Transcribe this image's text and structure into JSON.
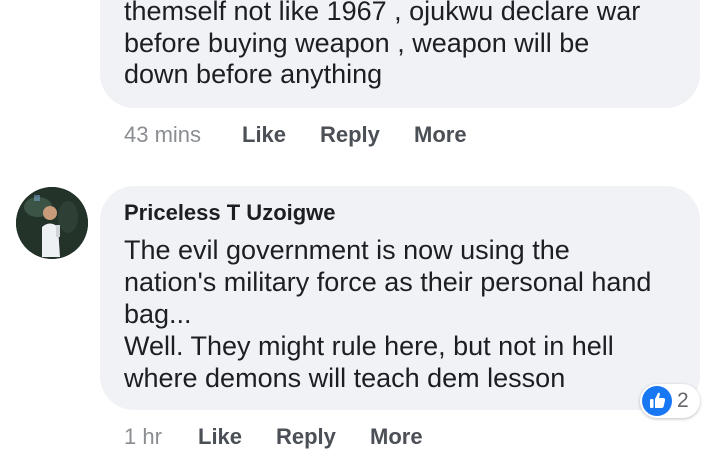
{
  "comment1": {
    "text": "themself not like 1967 , ojukwu declare war\nbefore buying weapon , weapon will be\ndown before anything",
    "time": "43 mins",
    "like_label": "Like",
    "reply_label": "Reply",
    "more_label": "More"
  },
  "comment2": {
    "author": "Priceless T Uzoigwe",
    "text": "The evil government is now using the\nnation's military force as their personal hand\nbag...\nWell. They might rule here, but not in hell\nwhere demons will teach dem lesson",
    "time": "1 hr",
    "like_label": "Like",
    "reply_label": "Reply",
    "more_label": "More",
    "reaction": {
      "icon": "thumbs-up-icon",
      "count": "2",
      "color": "#1877f2"
    }
  },
  "colors": {
    "bubble": "#f0f2f5",
    "text": "#1c1e21",
    "meta": "#65676b"
  }
}
